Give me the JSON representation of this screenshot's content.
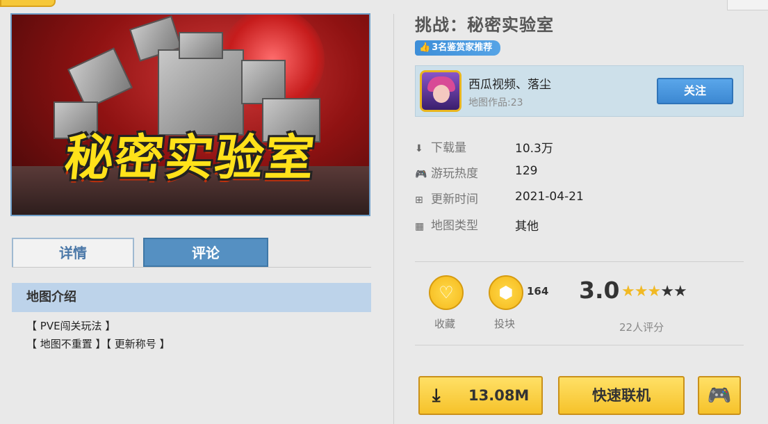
{
  "cover": {
    "art_title": "秘密实验室"
  },
  "tabs": [
    {
      "label": "详情"
    },
    {
      "label": "评论"
    }
  ],
  "intro": {
    "heading": "地图介绍",
    "lines": [
      "【 PVE闯关玩法 】",
      "【 地图不重置 】【 更新称号 】"
    ]
  },
  "map": {
    "title": "挑战：秘密实验室",
    "recommend_badge": "3名鉴赏家推荐"
  },
  "author": {
    "name": "西瓜视频、落尘",
    "works": "地图作品:23",
    "follow_label": "关注"
  },
  "stats": [
    {
      "icon": "download-icon",
      "label": "下载量",
      "value": "10.3万"
    },
    {
      "icon": "gamepad-icon",
      "label": "游玩热度",
      "value": "129"
    },
    {
      "icon": "plus-square-icon",
      "label": "更新时间",
      "value": "2021-04-21"
    },
    {
      "icon": "grid-icon",
      "label": "地图类型",
      "value": "其他"
    }
  ],
  "actions": {
    "favorite_label": "收藏",
    "cube_label": "投块",
    "cube_count": "164"
  },
  "rating": {
    "score": "3.0",
    "stars_filled": 3,
    "stars_total": 5,
    "count_label": "22人评分"
  },
  "buttons": {
    "download_size": "13.08M",
    "quick_join": "快速联机"
  },
  "colors": {
    "accent_yellow": "#f6c22a",
    "accent_blue": "#3c88d2",
    "tab_blue": "#5590c2"
  }
}
